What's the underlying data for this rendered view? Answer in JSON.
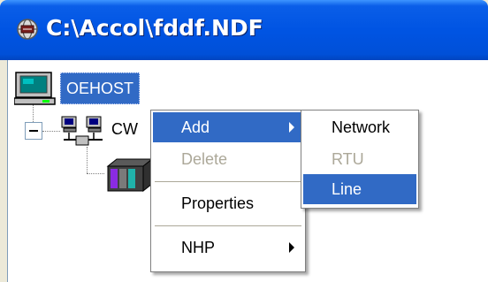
{
  "window": {
    "title": "C:\\Accol\\fddf.NDF",
    "title_icon": "network-globe-icon"
  },
  "tree": {
    "root_label": "OEHOST",
    "root_icon": "computer-icon",
    "child_label": "CW",
    "child_icon": "network-icon",
    "leaf_icon": "rtu-rack-icon"
  },
  "context_menu": {
    "items": [
      {
        "label": "Add",
        "state": "highlighted",
        "submenu": true
      },
      {
        "label": "Delete",
        "state": "disabled",
        "submenu": false
      },
      {
        "label": "Properties",
        "state": "normal",
        "submenu": false
      },
      {
        "label": "NHP",
        "state": "normal",
        "submenu": true
      }
    ]
  },
  "submenu": {
    "items": [
      {
        "label": "Network",
        "state": "normal"
      },
      {
        "label": "RTU",
        "state": "disabled"
      },
      {
        "label": "Line",
        "state": "highlighted"
      }
    ]
  },
  "colors": {
    "titlebar": "#0054e3",
    "highlight": "#316ac5",
    "disabled_text": "#aca899"
  }
}
